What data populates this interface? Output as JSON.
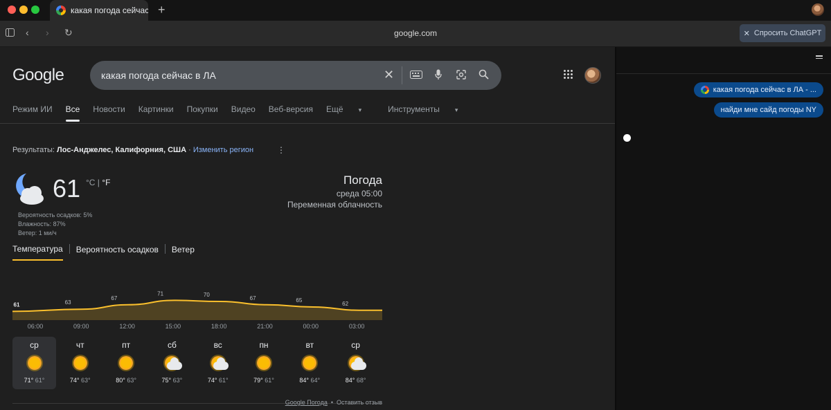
{
  "tab": {
    "title": "какая погода сейчас"
  },
  "toolbar": {
    "url": "google.com",
    "chatgpt_label": "Спросить ChatGPT"
  },
  "search": {
    "logo": "Google",
    "query": "какая погода сейчас в ЛА"
  },
  "nav": {
    "tabs": [
      {
        "label": "Режим ИИ"
      },
      {
        "label": "Все",
        "active": true
      },
      {
        "label": "Новости"
      },
      {
        "label": "Картинки"
      },
      {
        "label": "Покупки"
      },
      {
        "label": "Видео"
      },
      {
        "label": "Веб-версия"
      },
      {
        "label": "Ещё"
      },
      {
        "label": "Инструменты"
      }
    ]
  },
  "results": {
    "prefix": "Результаты: ",
    "location": "Лос-Анджелес, Калифорния, США",
    "change_region": "Изменить регион"
  },
  "weather": {
    "temperature": "61",
    "unit_c": "°C",
    "unit_f": "°F",
    "precip": "Вероятность осадков: 5%",
    "humidity": "Влажность: 87%",
    "wind": "Ветер: 1 ми/ч",
    "title": "Погода",
    "time": "среда 05:00",
    "condition": "Переменная облачность",
    "tabs": [
      "Температура",
      "Вероятность осадков",
      "Ветер"
    ]
  },
  "chart_data": {
    "type": "area",
    "x": [
      "06:00",
      "09:00",
      "12:00",
      "15:00",
      "18:00",
      "21:00",
      "00:00",
      "03:00"
    ],
    "values": [
      61,
      63,
      67,
      71,
      70,
      67,
      65,
      62
    ],
    "labels": [
      "61",
      "63",
      "67",
      "71",
      "70",
      "67",
      "65",
      "62"
    ],
    "color": "#fbc02d"
  },
  "forecast": [
    {
      "day": "ср",
      "icon": "sun",
      "hi": "71°",
      "lo": "61°",
      "selected": true
    },
    {
      "day": "чт",
      "icon": "sun",
      "hi": "74°",
      "lo": "63°"
    },
    {
      "day": "пт",
      "icon": "sun",
      "hi": "80°",
      "lo": "63°"
    },
    {
      "day": "сб",
      "icon": "partly-cloudy",
      "hi": "75°",
      "lo": "63°"
    },
    {
      "day": "вс",
      "icon": "partly-cloudy",
      "hi": "74°",
      "lo": "61°"
    },
    {
      "day": "пн",
      "icon": "sun",
      "hi": "79°",
      "lo": "61°"
    },
    {
      "day": "вт",
      "icon": "sun",
      "hi": "84°",
      "lo": "64°"
    },
    {
      "day": "ср",
      "icon": "partly-cloudy",
      "hi": "84°",
      "lo": "68°"
    }
  ],
  "footer": {
    "source": "Google Погода",
    "separator": "•",
    "feedback": "Оставить отзыв"
  },
  "chat": {
    "messages": [
      {
        "text": "какая погода сейчас в ЛА - ...",
        "has_icon": true
      },
      {
        "text": "найди мне сайд погоды NY",
        "has_icon": false
      }
    ]
  }
}
